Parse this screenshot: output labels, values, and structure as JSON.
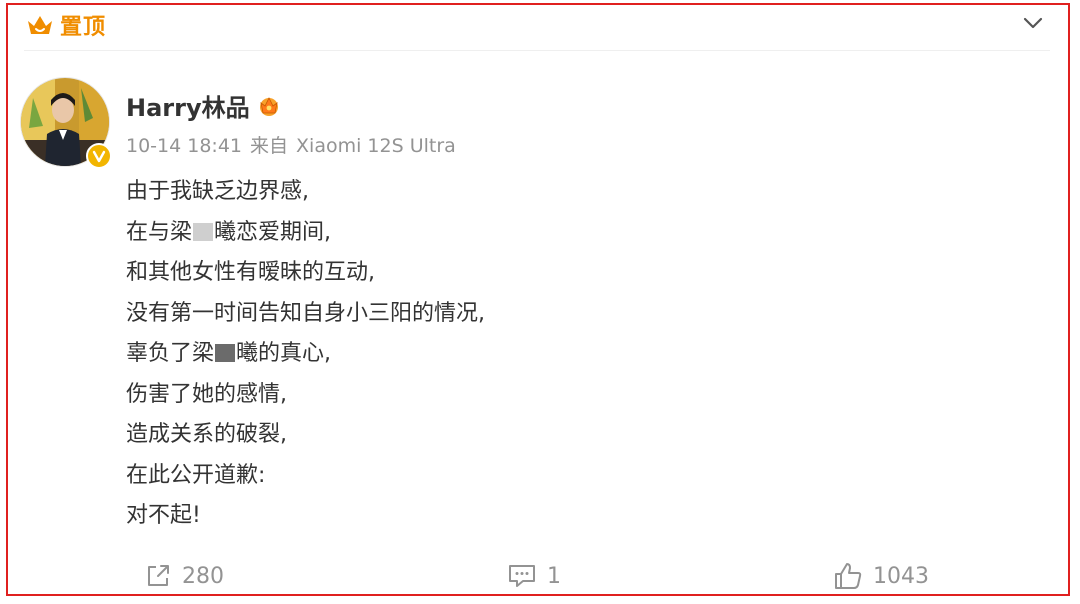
{
  "pin": {
    "icon": "crown-pin-icon",
    "label": "置顶",
    "color": "#f08d00"
  },
  "collapse": {
    "icon": "chevron-down-icon"
  },
  "post": {
    "username": "Harry林品",
    "badge_icon": "vip-crown-icon",
    "verified_icon": "verified-v-icon",
    "time": "10-14 18:41",
    "source_prefix": "来自",
    "source_device": "Xiaomi 12S Ultra",
    "lines": [
      "由于我缺乏边界感,",
      {
        "before": "在与梁",
        "mask": "light",
        "after": "曦恋爱期间,"
      },
      "和其他女性有暧昧的互动,",
      "没有第一时间告知自身小三阳的情况,",
      {
        "before": "辜负了梁",
        "mask": "dark",
        "after": "曦的真心,"
      },
      "伤害了她的感情,",
      "造成关系的破裂,",
      "在此公开道歉:",
      "对不起!"
    ]
  },
  "actions": {
    "repost": {
      "icon": "repost-icon",
      "count": "280"
    },
    "comment": {
      "icon": "comment-icon",
      "count": "1"
    },
    "like": {
      "icon": "thumbs-up-icon",
      "count": "1043"
    }
  },
  "colors": {
    "frame": "#e0201f",
    "meta_text": "#939393",
    "body_text": "#333333"
  }
}
